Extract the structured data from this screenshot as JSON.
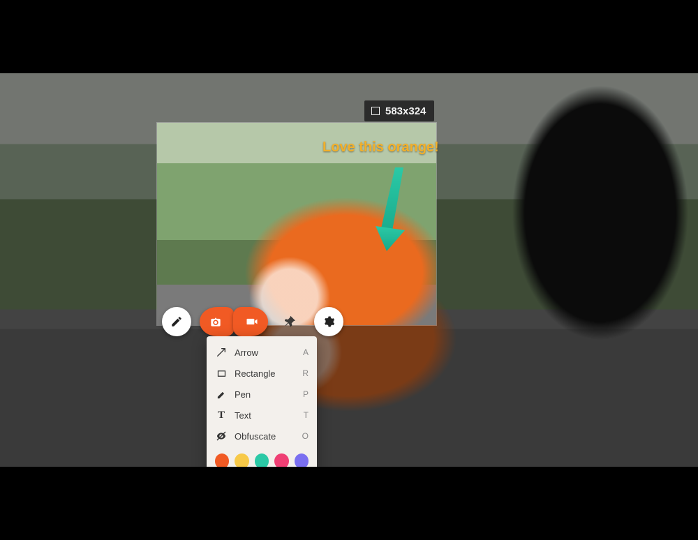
{
  "selection": {
    "dimensions_label": "583x324"
  },
  "annotation": {
    "text": "Love this orange!",
    "text_color": "#f2b02b",
    "arrow_color": "#2bc9a6"
  },
  "toolbar": {
    "edit_tool": "edit",
    "capture_tool": "capture",
    "record_tool": "record",
    "pin_tool": "pin",
    "settings_tool": "settings"
  },
  "menu": {
    "items": [
      {
        "label": "Arrow",
        "shortcut": "A",
        "icon": "arrow-icon"
      },
      {
        "label": "Rectangle",
        "shortcut": "R",
        "icon": "rectangle-icon"
      },
      {
        "label": "Pen",
        "shortcut": "P",
        "icon": "pen-icon"
      },
      {
        "label": "Text",
        "shortcut": "T",
        "icon": "text-icon"
      },
      {
        "label": "Obfuscate",
        "shortcut": "O",
        "icon": "obfuscate-icon"
      }
    ],
    "colors": [
      "#f15a24",
      "#f7c948",
      "#2bc9a6",
      "#ef3f74",
      "#7a6ff0"
    ]
  }
}
